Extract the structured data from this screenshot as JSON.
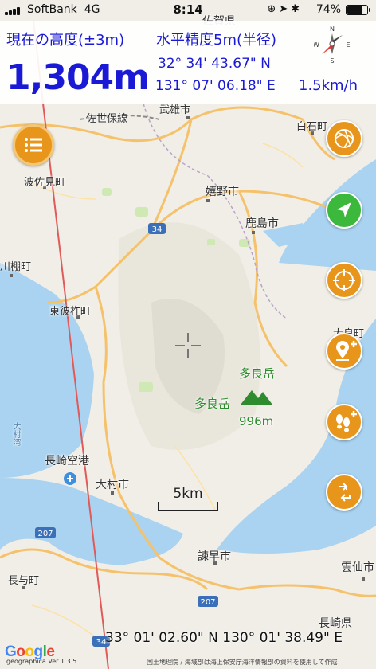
{
  "status_bar": {
    "carrier": "SoftBank",
    "network": "4G",
    "time": "8:14",
    "battery": "74%",
    "battery_fraction": 0.74
  },
  "header": {
    "altitude_label": "現在の高度(±3m)",
    "accuracy_label": "水平精度5m(半径)",
    "altitude": "1,304m",
    "latitude": "32° 34' 43.67\" N",
    "longitude": "131° 07' 06.18\" E",
    "speed": "1.5km/h",
    "compass": {
      "n": "N",
      "s": "S",
      "e": "E",
      "w": "W"
    }
  },
  "map": {
    "labels": {
      "saga": "佐賀県",
      "takeo": "武雄市",
      "sasebo_line": "佐世保線",
      "shiroishi": "白石町",
      "hasami": "波佐見町",
      "ureshino": "嬉野市",
      "kashima": "鹿島市",
      "kawatana": "川棚町",
      "higashisonogi": "東彼杵町",
      "tara": "太良町",
      "peak1": "多良岳",
      "peak2": "多良岳",
      "peak_elevation": "996m",
      "omura_bay": "大村湾",
      "airport": "長崎空港",
      "omura": "大村市",
      "isahaya": "諫早市",
      "unzen": "雲仙市",
      "nagayo": "長与町",
      "nagasaki": "長崎県",
      "route34a": "34",
      "route34b": "34",
      "route207a": "207",
      "route207b": "207",
      "route34c": "34"
    },
    "scale": "5km",
    "bottom_coordinate": "33° 01' 02.60\" N 130° 01' 38.49\" E",
    "google": "Google",
    "version": "geographica Ver 1.3.5",
    "attribution": "国土地理院 / 海域部は海上保安庁海洋情報部の資料を使用して作成"
  },
  "colors": {
    "header_text": "#1a1ad6",
    "button_orange": "#e8951c",
    "button_green": "#3cb83c",
    "sea": "#a9d3f0",
    "road": "#f5c26b",
    "track_line": "#e05a5a"
  },
  "icons": [
    "compass-icon",
    "menu-icon",
    "swirl-icon",
    "navigation-arrow-icon",
    "target-icon",
    "add-pin-icon",
    "footprints-add-icon",
    "route-icon",
    "crosshair-icon",
    "mountain-icon"
  ]
}
